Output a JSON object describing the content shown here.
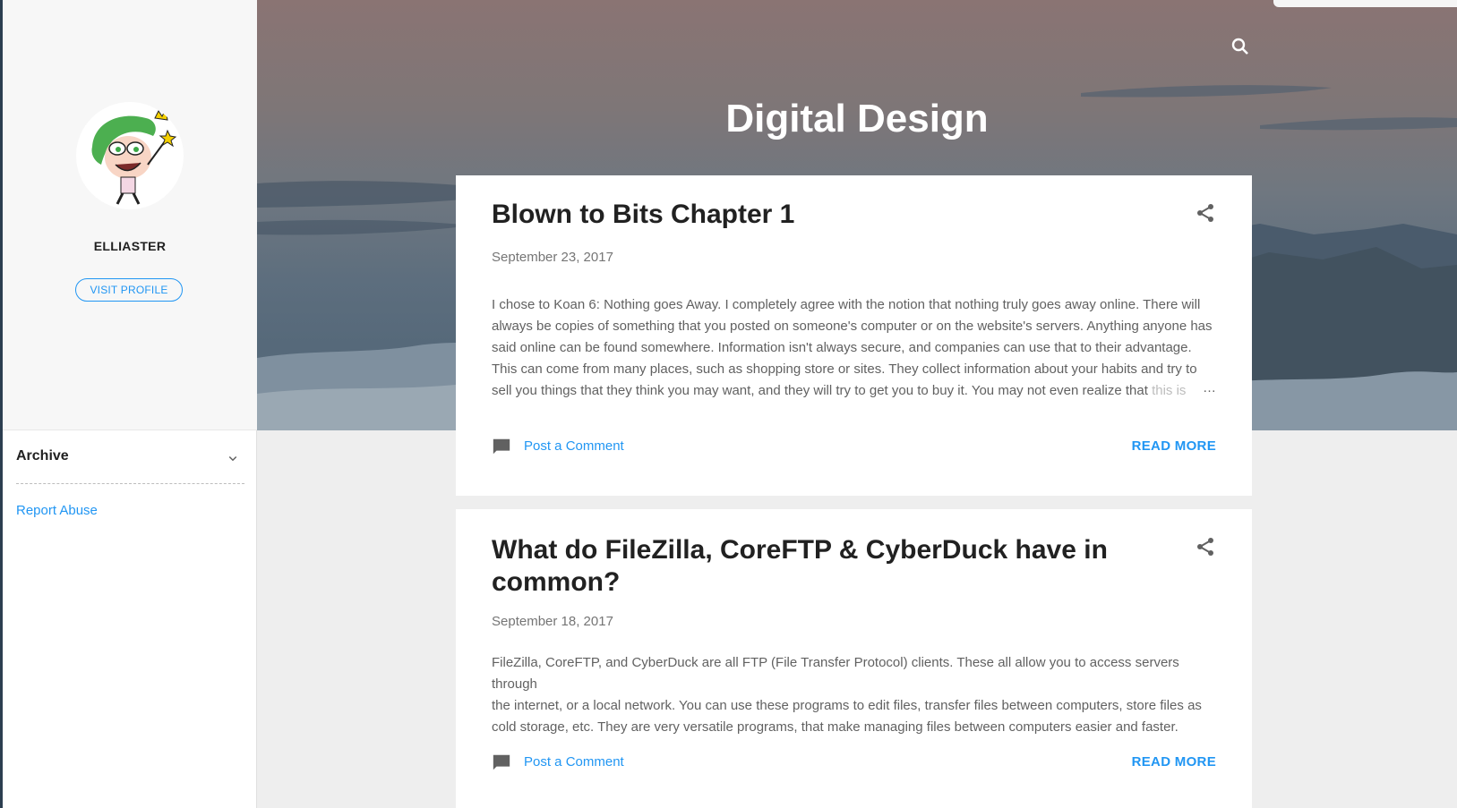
{
  "header": {
    "site_title": "Digital Design",
    "search_icon": "search-icon"
  },
  "sidebar": {
    "profile_name": "ELLIASTER",
    "visit_profile_label": "VISIT PROFILE",
    "avatar_icon": "cartoon-avatar",
    "archive_label": "Archive",
    "report_abuse_label": "Report Abuse"
  },
  "posts": [
    {
      "title": "Blown to Bits Chapter 1",
      "date": "September 23, 2017",
      "body_lines": [
        "I chose to Koan 6: Nothing goes Away. I completely agree with the notion that nothing truly goes away online. There will",
        "always be copies of something that you posted on someone's computer or on the website's servers. Anything anyone has",
        "said online can be found somewhere. Information isn't always secure, and companies can use that to their advantage.",
        "This can come from many places, such as shopping store or sites. They collect information about your habits and try to",
        "sell you things that they think you may want, and they will try to get you to buy it. You may not even realize that"
      ],
      "body_fade_tail": "this is",
      "ellipsis": "…",
      "comment_label": "Post a Comment",
      "read_more_label": "READ MORE"
    },
    {
      "title": "What do FileZilla, CoreFTP & CyberDuck have in common?",
      "date": "September 18, 2017",
      "body_lines": [
        "FileZilla, CoreFTP, and CyberDuck are all FTP (File Transfer Protocol) clients. These all allow you to access servers through",
        "the internet, or a local network. You can use these programs to edit files, transfer files between computers, store files as",
        "cold storage, etc. They are very versatile programs, that make managing files between computers easier and faster."
      ],
      "comment_label": "Post a Comment",
      "read_more_label": "READ MORE"
    }
  ],
  "colors": {
    "accent": "#2196f3",
    "title_text": "#212121",
    "body_text": "#616161",
    "page_bg": "#eeeeee"
  }
}
